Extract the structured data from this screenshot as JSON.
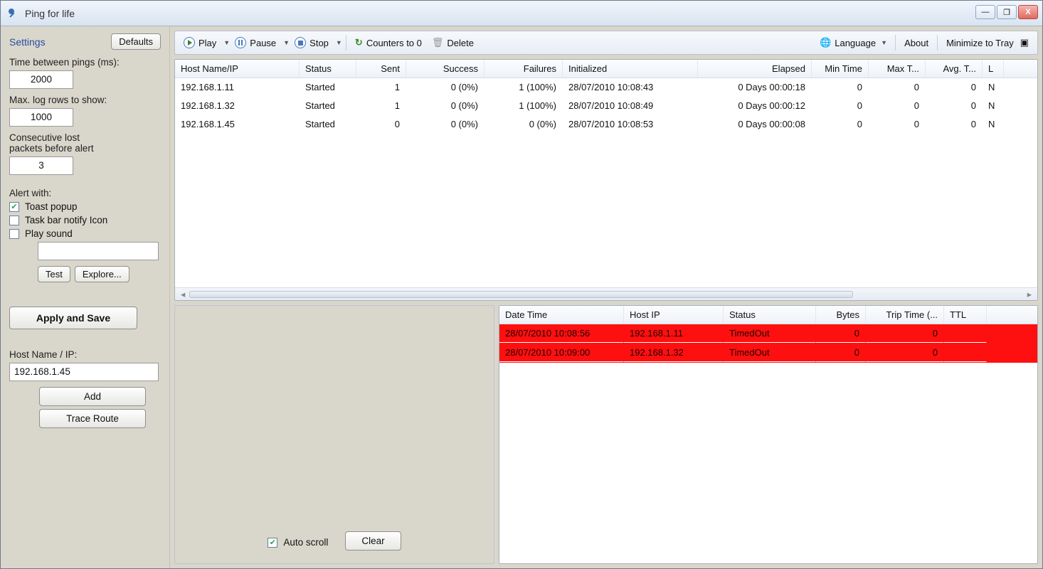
{
  "window": {
    "title": "Ping for life"
  },
  "winbuttons": {
    "min": "—",
    "max": "❐",
    "close": "X"
  },
  "sidebar": {
    "settings_label": "Settings",
    "defaults_btn": "Defaults",
    "time_label": "Time between pings (ms):",
    "time_value": "2000",
    "maxlog_label": "Max. log rows to show:",
    "maxlog_value": "1000",
    "consec_label_1": "Consecutive lost",
    "consec_label_2": "packets before alert",
    "consec_value": "3",
    "alert_label": "Alert with:",
    "checks": [
      {
        "label": "Toast popup",
        "checked": true
      },
      {
        "label": "Task bar notify Icon",
        "checked": false
      },
      {
        "label": "Play sound",
        "checked": false
      }
    ],
    "sound_path": "",
    "test_btn": "Test",
    "explore_btn": "Explore...",
    "apply_btn": "Apply and Save",
    "hostip_label": "Host Name / IP:",
    "hostip_value": "192.168.1.45",
    "add_btn": "Add",
    "trace_btn": "Trace Route"
  },
  "toolbar": {
    "play": "Play",
    "pause": "Pause",
    "stop": "Stop",
    "counters": "Counters to 0",
    "delete": "Delete",
    "language": "Language",
    "about": "About",
    "minimize": "Minimize to Tray"
  },
  "hostgrid": {
    "headers": [
      "Host Name/IP",
      "Status",
      "Sent",
      "Success",
      "Failures",
      "Initialized",
      "Elapsed",
      "Min Time",
      "Max T...",
      "Avg. T...",
      "L"
    ],
    "rows": [
      {
        "host": "192.168.1.11",
        "status": "Started",
        "sent": "1",
        "success": "0 (0%)",
        "failures": "1 (100%)",
        "init": "28/07/2010 10:08:43",
        "elapsed": "0 Days 00:00:18",
        "min": "0",
        "max": "0",
        "avg": "0",
        "l": "N"
      },
      {
        "host": "192.168.1.32",
        "status": "Started",
        "sent": "1",
        "success": "0 (0%)",
        "failures": "1 (100%)",
        "init": "28/07/2010 10:08:49",
        "elapsed": "0 Days 00:00:12",
        "min": "0",
        "max": "0",
        "avg": "0",
        "l": "N"
      },
      {
        "host": "192.168.1.45",
        "status": "Started",
        "sent": "0",
        "success": "0 (0%)",
        "failures": "0 (0%)",
        "init": "28/07/2010 10:08:53",
        "elapsed": "0 Days 00:00:08",
        "min": "0",
        "max": "0",
        "avg": "0",
        "l": "N"
      }
    ]
  },
  "lowerleft": {
    "autoscroll_label": "Auto scroll",
    "autoscroll_checked": true,
    "clear_btn": "Clear"
  },
  "loggrid": {
    "headers": [
      "Date Time",
      "Host IP",
      "Status",
      "Bytes",
      "Trip Time (...",
      "TTL"
    ],
    "rows": [
      {
        "dt": "28/07/2010 10:08:56",
        "ip": "192.168.1.11",
        "status": "TimedOut",
        "bytes": "0",
        "trip": "0",
        "ttl": ""
      },
      {
        "dt": "28/07/2010 10:09:00",
        "ip": "192.168.1.32",
        "status": "TimedOut",
        "bytes": "0",
        "trip": "0",
        "ttl": ""
      }
    ]
  }
}
